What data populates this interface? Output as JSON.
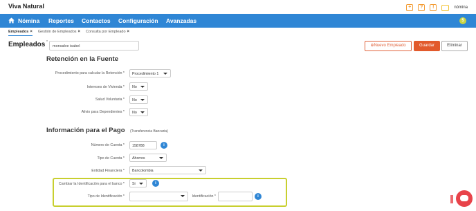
{
  "brand": {
    "name": "Viva Natural"
  },
  "topbar": {
    "icons": [
      {
        "name": "plus-icon",
        "glyph": "+"
      },
      {
        "name": "help-icon",
        "glyph": "?"
      },
      {
        "name": "alert-icon",
        "glyph": "!"
      }
    ],
    "module_label": "nómina"
  },
  "navbar": {
    "items": [
      "Nómina",
      "Reportes",
      "Contactos",
      "Configuración",
      "Avanzadas"
    ],
    "badge": "5"
  },
  "tabs": [
    {
      "label": "Empleados",
      "active": true
    },
    {
      "label": "Gestión de Empleados",
      "active": false
    },
    {
      "label": "Consulta por Empleado",
      "active": false
    }
  ],
  "header": {
    "title": "Empleados",
    "required_mark": "*",
    "employee_value": "monsalve isabel",
    "btn_new": "Nuevo Empleado",
    "btn_save": "Guardar",
    "btn_delete": "Eliminar"
  },
  "retencion": {
    "title": "Retención en la Fuente",
    "fields": [
      {
        "label": "Procedimiento para calcular la Retención *",
        "value": "Procedimiento 1"
      },
      {
        "label": "Intereses de Vivienda *",
        "value": "No"
      },
      {
        "label": "Salud Voluntaria *",
        "value": "No"
      },
      {
        "label": "Alivio para Dependientes *",
        "value": "No"
      }
    ]
  },
  "pago": {
    "title": "Información para el Pago",
    "subtitle": "(Transferencia Bancaria)",
    "account_number_label": "Número de Cuenta *",
    "account_number": "158788",
    "account_type_label": "Tipo de Cuenta *",
    "account_type": "Ahorros",
    "bank_label": "Entidad Financiera *",
    "bank": "Bancolombia",
    "change_id_label": "Cambiar la Identificación para el banco *",
    "change_id_value": "Si",
    "id_type_label": "Tipo de Identificación *",
    "id_type_value": "",
    "id_label": "Identificación *",
    "id_value": ""
  },
  "colors": {
    "nav_blue": "#2f86d5",
    "accent_orange": "#e25a2c",
    "highlight": "#c8cf2f",
    "chat_red": "#e8434a"
  }
}
